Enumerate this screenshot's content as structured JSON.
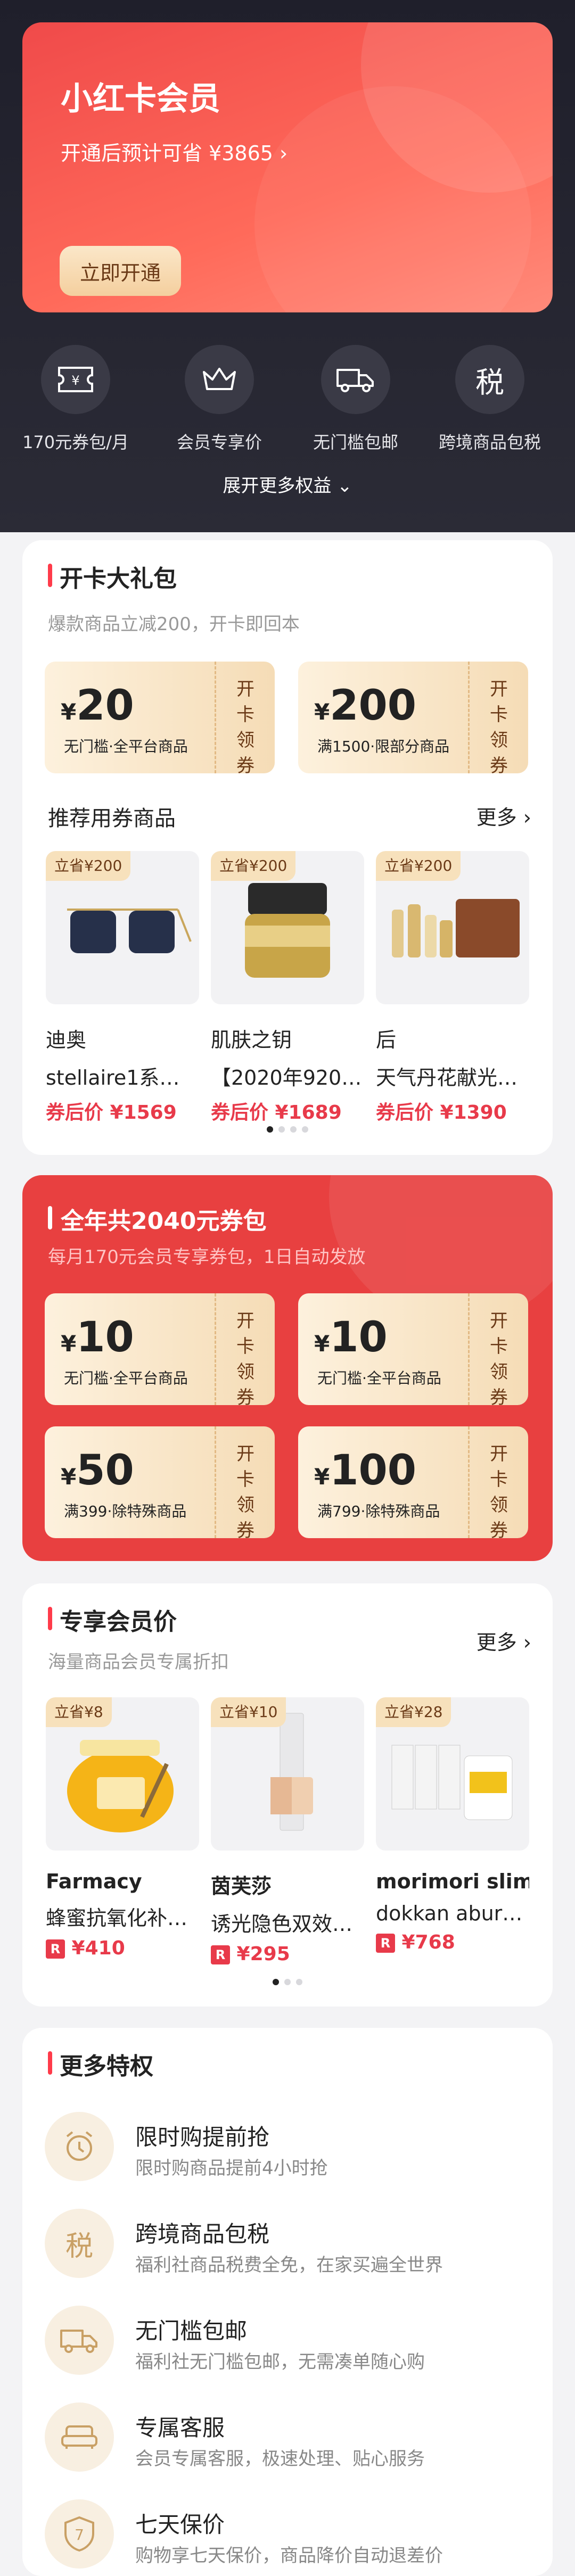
{
  "hero": {
    "title": "小红卡会员",
    "subtitle": "开通后预计可省 ¥3865 ›",
    "button": "立即开通"
  },
  "benefits": [
    {
      "icon": "ticket-yen-icon",
      "label": "170元券包/月"
    },
    {
      "icon": "crown-icon",
      "label": "会员专享价"
    },
    {
      "icon": "truck-icon",
      "label": "无门槛包邮"
    },
    {
      "icon": "tax-icon",
      "label": "跨境商品包税",
      "glyph": "税"
    }
  ],
  "more_rights": "展开更多权益 ⌄",
  "gift": {
    "title": "开卡大礼包",
    "subtitle": "爆款商品立减200，开卡即回本",
    "coupons": [
      {
        "currency": "¥",
        "amount": "20",
        "desc": "无门槛·全平台商品",
        "action": "开卡领券"
      },
      {
        "currency": "¥",
        "amount": "200",
        "desc": "满1500·限部分商品",
        "action": "开卡领券"
      }
    ],
    "rec_title": "推荐用券商品",
    "more": "更多 ›",
    "products": [
      {
        "tag": "立省¥200",
        "brand": "迪奥",
        "name": "stellaire1系列…",
        "price": "券后价 ¥1569",
        "icon": "sunglasses-icon"
      },
      {
        "tag": "立省¥200",
        "brand": "肌肤之钥",
        "name": "【2020年920】…",
        "price": "券后价 ¥1689",
        "icon": "cream-jar-icon"
      },
      {
        "tag": "立省¥200",
        "brand": "后",
        "name": "天气丹花献光彩…",
        "price": "券后价 ¥1390",
        "icon": "skincare-set-icon"
      }
    ]
  },
  "package": {
    "title": "全年共2040元券包",
    "subtitle": "每月170元会员专享券包，1日自动发放",
    "coupons": [
      {
        "currency": "¥",
        "amount": "10",
        "desc": "无门槛·全平台商品",
        "action": "开卡领券"
      },
      {
        "currency": "¥",
        "amount": "10",
        "desc": "无门槛·全平台商品",
        "action": "开卡领券"
      },
      {
        "currency": "¥",
        "amount": "50",
        "desc": "满399·除特殊商品",
        "action": "开卡领券"
      },
      {
        "currency": "¥",
        "amount": "100",
        "desc": "满799·除特殊商品",
        "action": "开卡领券"
      }
    ]
  },
  "member_price": {
    "title": "专享会员价",
    "subtitle": "海量商品会员专属折扣",
    "more": "更多 ›",
    "products": [
      {
        "tag": "立省¥8",
        "brand": "Farmacy",
        "name": "蜂蜜抗氧化补水…",
        "price": "¥410",
        "icon": "honey-jar-icon"
      },
      {
        "tag": "立省¥10",
        "brand": "茵芙莎",
        "name": "诱光隐色双效维…",
        "price": "¥295",
        "icon": "concealer-icon"
      },
      {
        "tag": "立省¥28",
        "brand": "morimori slim",
        "name": "dokkan abura…",
        "price": "¥768",
        "icon": "supplement-box-icon"
      }
    ],
    "price_badge": "R"
  },
  "perks": {
    "title": "更多特权",
    "items": [
      {
        "icon": "alarm-clock-icon",
        "title": "限时购提前抢",
        "desc": "限时购商品提前4小时抢"
      },
      {
        "icon": "tax-icon",
        "glyph": "税",
        "title": "跨境商品包税",
        "desc": "福利社商品税费全免，在家买遍全世界"
      },
      {
        "icon": "truck-icon",
        "title": "无门槛包邮",
        "desc": "福利社无门槛包邮，无需凑单随心购"
      },
      {
        "icon": "sofa-icon",
        "title": "专属客服",
        "desc": "会员专属客服，极速处理、贴心服务"
      },
      {
        "icon": "shield-seven-icon",
        "glyph": "7",
        "title": "七天保价",
        "desc": "购物享七天保价，商品降价自动退差价"
      }
    ]
  },
  "colors": {
    "accent": "#e84040",
    "gold": "#f4cf9e",
    "dark": "#23232d"
  }
}
